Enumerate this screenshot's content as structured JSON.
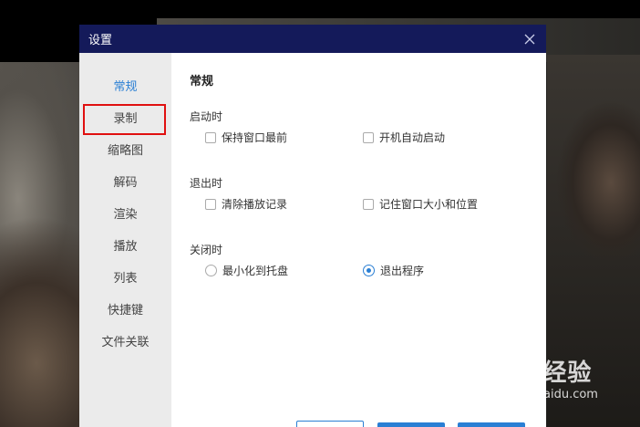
{
  "dialog": {
    "title": "设置",
    "close_label": "×"
  },
  "sidebar": {
    "items": [
      {
        "label": "常规"
      },
      {
        "label": "录制"
      },
      {
        "label": "缩略图"
      },
      {
        "label": "解码"
      },
      {
        "label": "渲染"
      },
      {
        "label": "播放"
      },
      {
        "label": "列表"
      },
      {
        "label": "快捷键"
      },
      {
        "label": "文件关联"
      }
    ],
    "active_index": 0,
    "highlighted_index": 1
  },
  "content": {
    "section_title": "常规",
    "groups": [
      {
        "label": "启动时",
        "options": [
          {
            "label": "保持窗口最前",
            "type": "checkbox",
            "checked": false
          },
          {
            "label": "开机自动启动",
            "type": "checkbox",
            "checked": false
          }
        ]
      },
      {
        "label": "退出时",
        "options": [
          {
            "label": "清除播放记录",
            "type": "checkbox",
            "checked": false
          },
          {
            "label": "记住窗口大小和位置",
            "type": "checkbox",
            "checked": false
          }
        ]
      },
      {
        "label": "关闭时",
        "options": [
          {
            "label": "最小化到托盘",
            "type": "radio",
            "checked": false
          },
          {
            "label": "退出程序",
            "type": "radio",
            "checked": true
          }
        ]
      }
    ]
  },
  "watermark": {
    "main": "Bai 经验",
    "sub": "jingyan.baidu.com"
  },
  "colors": {
    "titlebar": "#141a5a",
    "accent": "#2a7fd4",
    "highlight_box": "#e01010",
    "sidebar_bg": "#ebebeb"
  }
}
